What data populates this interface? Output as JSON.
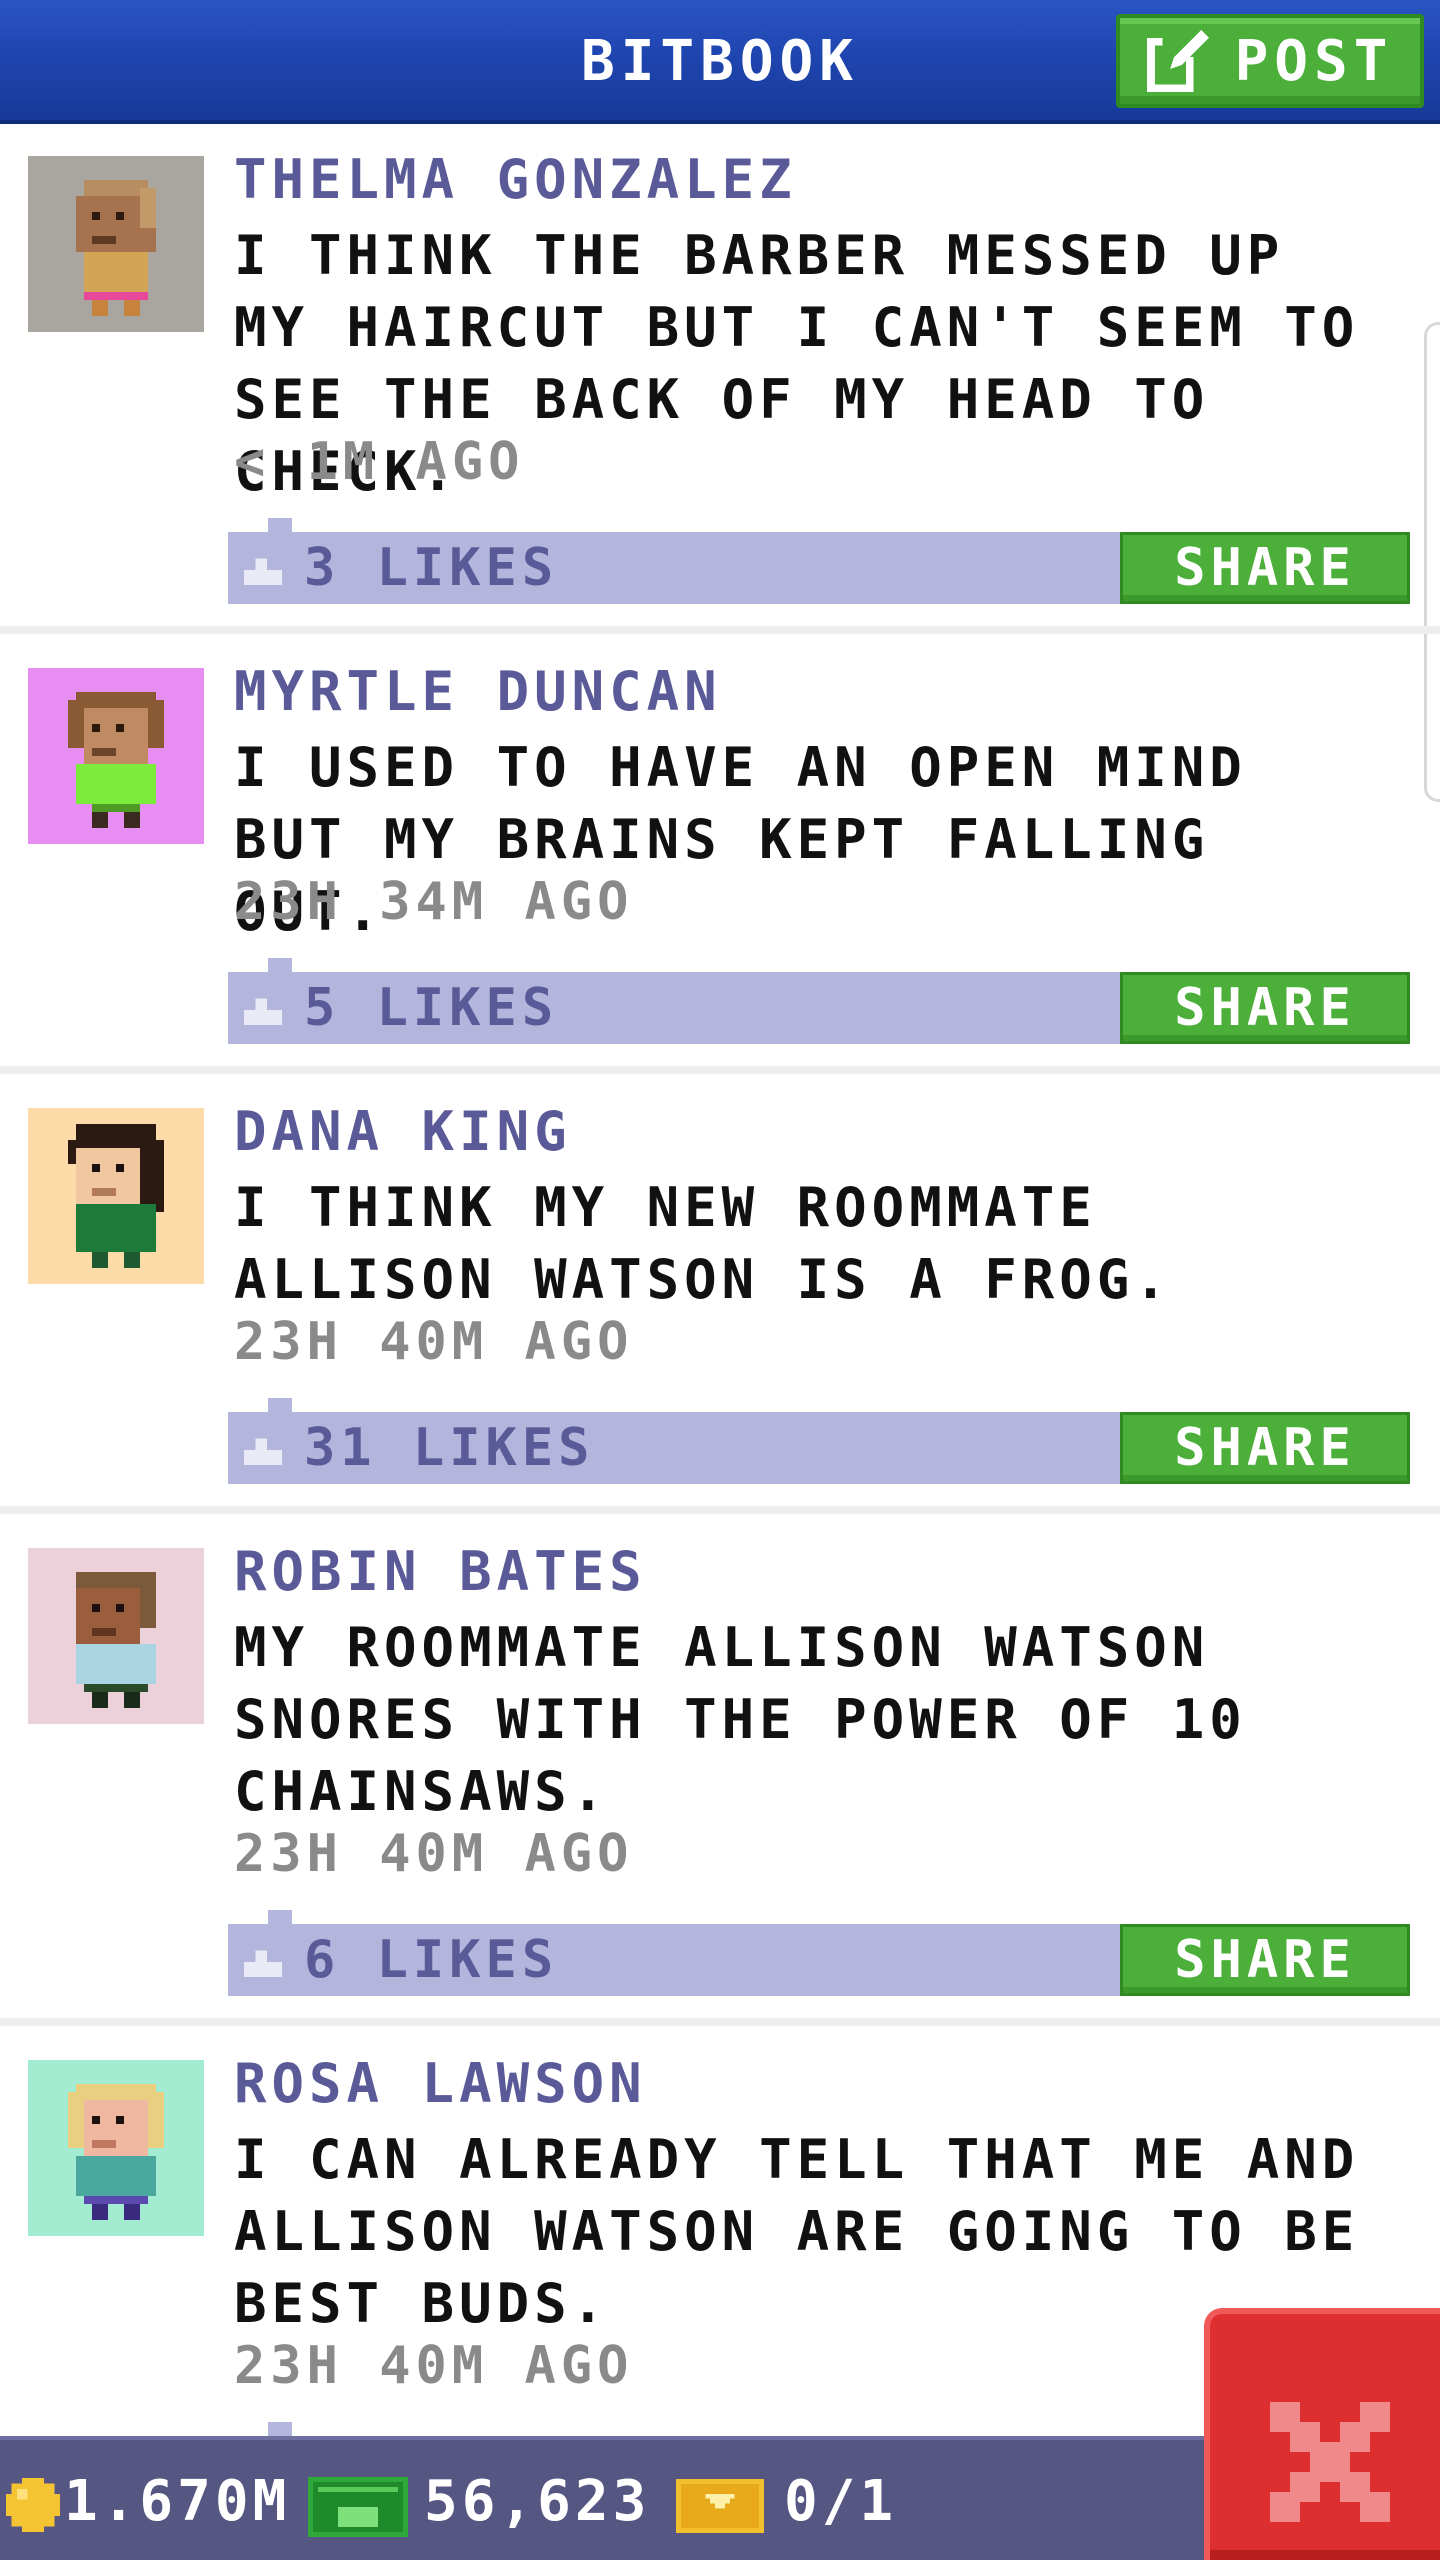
{
  "app": {
    "title": "BITBOOK",
    "post_label": "POST",
    "share_label": "SHARE"
  },
  "posts": [
    {
      "author": "THELMA GONZALEZ",
      "text": "I THINK THE BARBER MESSED UP MY HAIRCUT BUT I CAN'T SEEM TO SEE THE BACK OF MY HEAD TO CHECK.",
      "time": "< 1M AGO",
      "likes": "3 LIKES",
      "avatar_bg": "#a9a6a0"
    },
    {
      "author": "MYRTLE DUNCAN",
      "text": "I USED TO HAVE AN OPEN MIND BUT MY BRAINS KEPT FALLING OUT.",
      "time": "23H 34M AGO",
      "likes": "5 LIKES",
      "avatar_bg": "#e88ef3"
    },
    {
      "author": "DANA KING",
      "text": "I THINK MY NEW ROOMMATE ALLISON WATSON IS A FROG.",
      "time": "23H 40M AGO",
      "likes": "31 LIKES",
      "avatar_bg": "#fcdba9"
    },
    {
      "author": "ROBIN BATES",
      "text": "MY ROOMMATE ALLISON WATSON SNORES WITH THE POWER OF 10 CHAINSAWS.",
      "time": "23H 40M AGO",
      "likes": "6 LIKES",
      "avatar_bg": "#ecd0da"
    },
    {
      "author": "ROSA LAWSON",
      "text": "I CAN ALREADY TELL THAT ME AND ALLISON WATSON ARE GOING TO BE BEST BUDS.",
      "time": "23H 40M AGO",
      "likes": "",
      "avatar_bg": "#a3ecd1"
    }
  ],
  "footer": {
    "coins": "1.670M",
    "cash": "56,623",
    "tickets": "0/1"
  },
  "colors": {
    "header_blue": "#1f45b0",
    "share_green": "#4caf3a",
    "like_bar": "#b3b5dc",
    "author_purple": "#5a5a98",
    "footer": "#565682",
    "close_red": "#dd2f2f"
  }
}
